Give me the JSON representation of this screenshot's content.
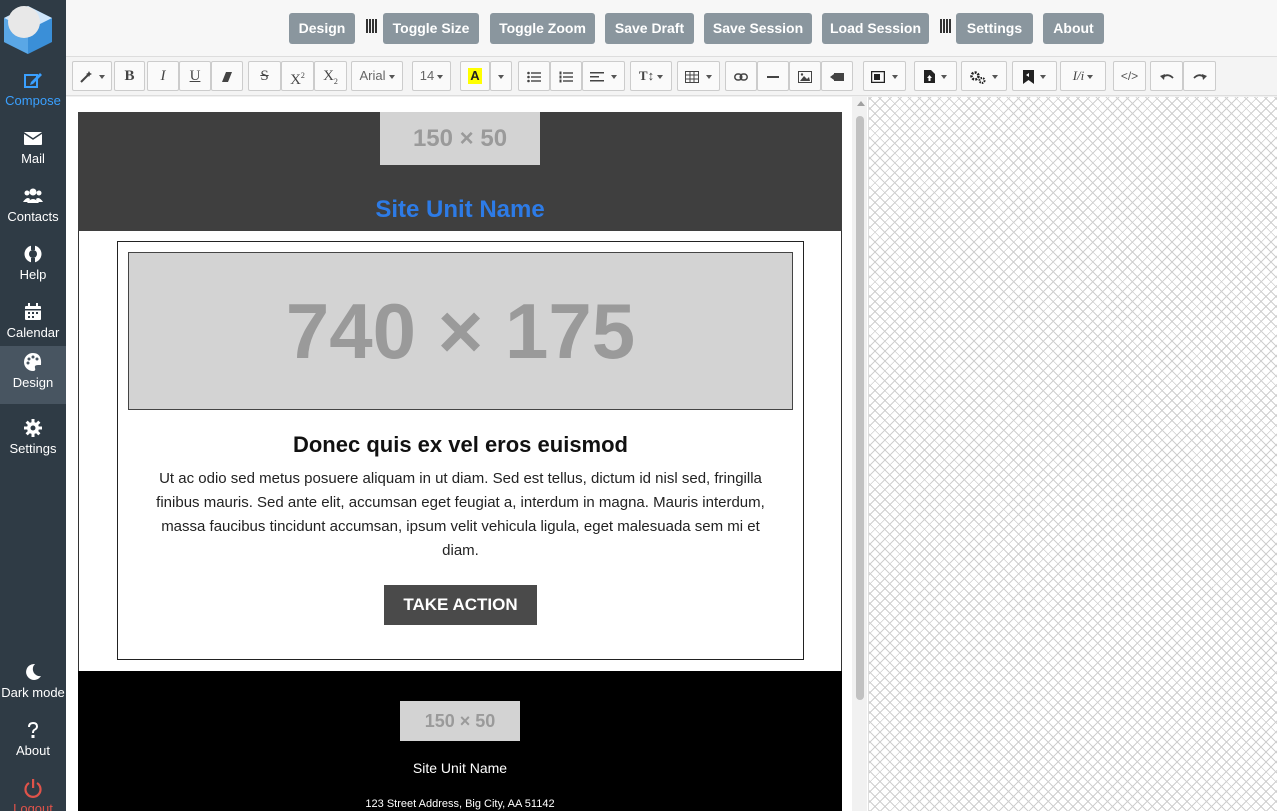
{
  "sidebar": {
    "items": [
      {
        "label": "Compose",
        "icon": "compose-icon"
      },
      {
        "label": "Mail",
        "icon": "mail-icon"
      },
      {
        "label": "Contacts",
        "icon": "contacts-icon"
      },
      {
        "label": "Help",
        "icon": "help-icon"
      },
      {
        "label": "Calendar",
        "icon": "calendar-icon"
      },
      {
        "label": "Design",
        "icon": "palette-icon"
      },
      {
        "label": "Settings",
        "icon": "gear-icon"
      }
    ],
    "bottom": [
      {
        "label": "Dark mode",
        "icon": "moon-icon"
      },
      {
        "label": "About",
        "icon": "question-icon"
      },
      {
        "label": "Logout",
        "icon": "power-icon"
      }
    ],
    "active": "Compose",
    "accent": "#3aa0ff",
    "logout_color": "#e0534a"
  },
  "topbar": {
    "buttons": [
      "Design",
      "Toggle Size",
      "Toggle Zoom",
      "Save Draft",
      "Save Session",
      "Load Session",
      "Settings",
      "About"
    ]
  },
  "toolbar": {
    "font_family": "Arial",
    "font_size": "14",
    "highlight_label": "A"
  },
  "email": {
    "header_logo": "150 × 50",
    "site_name": "Site Unit Name",
    "hero_placeholder": "740 × 175",
    "title": "Donec quis ex vel eros euismod",
    "body": "Ut ac odio sed metus posuere aliquam in ut diam. Sed est tellus, dictum id nisl sed, fringilla finibus mauris. Sed ante elit, accumsan eget feugiat a, interdum in magna. Mauris interdum, massa faucibus tincidunt accumsan, ipsum velit vehicula ligula, eget malesuada sem mi et diam.",
    "cta": "TAKE ACTION",
    "footer_logo": "150 × 50",
    "footer_name": "Site Unit Name",
    "footer_address": "123 Street Address, Big City, AA 51142"
  }
}
